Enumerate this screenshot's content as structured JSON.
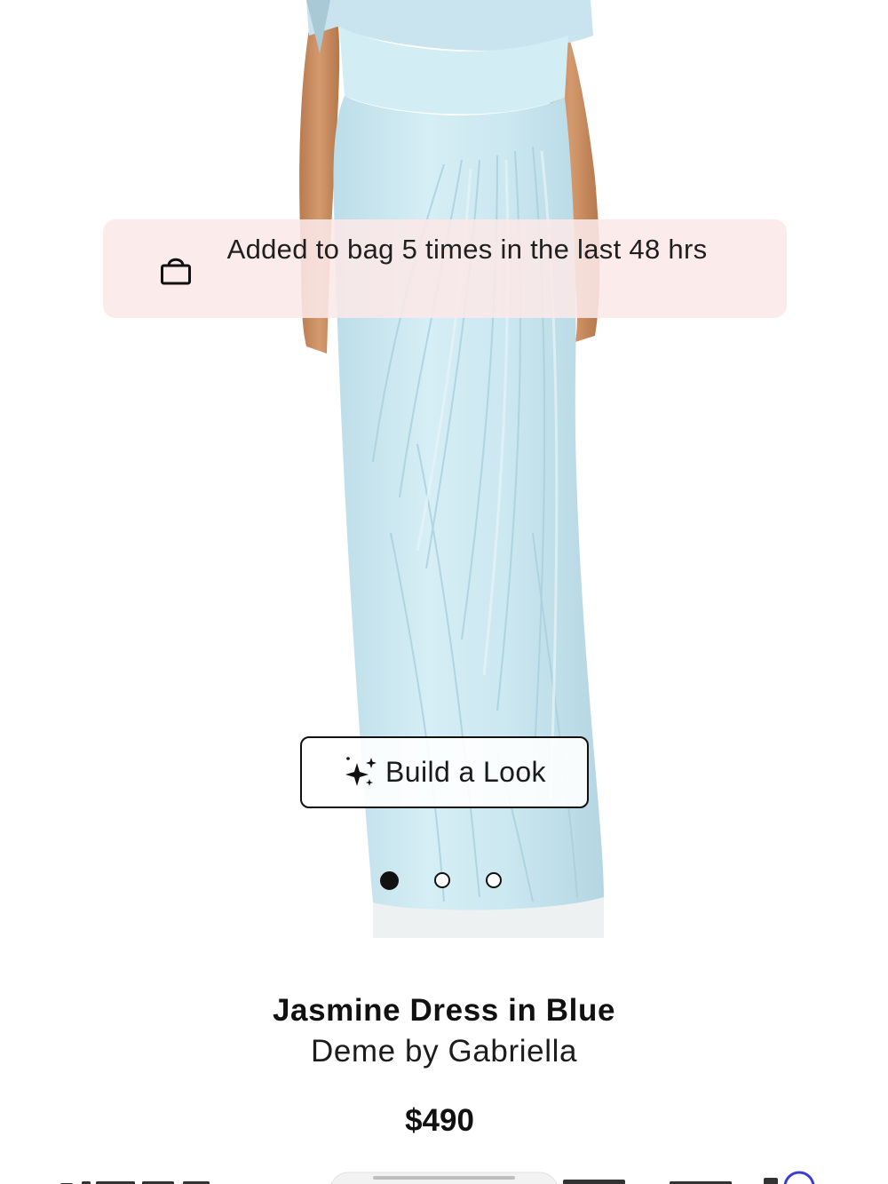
{
  "social_proof": {
    "text": "Added to bag 5 times in the last 48 hrs",
    "icon": "shopping-bag-icon"
  },
  "build_look": {
    "label": "Build a Look",
    "icon": "sparkles-icon"
  },
  "carousel": {
    "total_images": 3,
    "active_index": 0
  },
  "product": {
    "title": "Jasmine Dress in Blue",
    "brand": "Deme by Gabriella",
    "price": "$490"
  },
  "colors": {
    "dress": "#cde8f0",
    "banner_bg": "#fce8e8",
    "skin": "#c98a5e",
    "text": "#111111"
  }
}
